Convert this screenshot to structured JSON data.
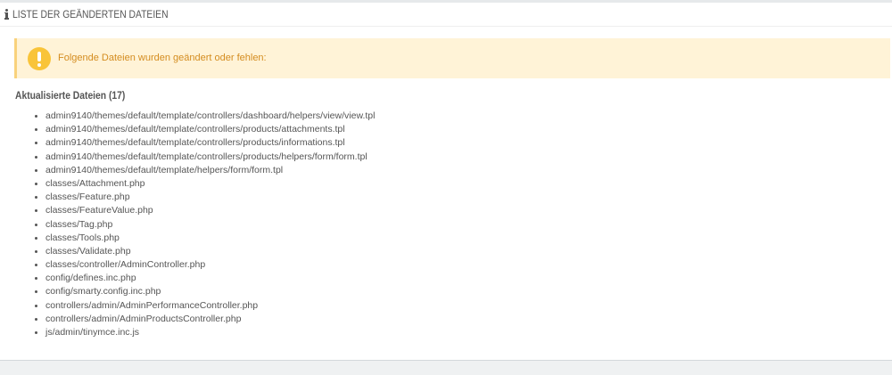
{
  "panel": {
    "title": "Liste der geänderten Dateien",
    "title_icon": "info-icon"
  },
  "alert": {
    "icon": "warning-icon",
    "message": "Folgende Dateien wurden geändert oder fehlen:",
    "colors": {
      "background": "#fff3d7",
      "border": "#f9d27c",
      "icon": "#f9c439",
      "text": "#d48c1f"
    }
  },
  "updated_files": {
    "heading": "Aktualisierte Dateien (17)",
    "items": [
      "admin9140/themes/default/template/controllers/dashboard/helpers/view/view.tpl",
      "admin9140/themes/default/template/controllers/products/attachments.tpl",
      "admin9140/themes/default/template/controllers/products/informations.tpl",
      "admin9140/themes/default/template/controllers/products/helpers/form/form.tpl",
      "admin9140/themes/default/template/helpers/form/form.tpl",
      "classes/Attachment.php",
      "classes/Feature.php",
      "classes/FeatureValue.php",
      "classes/Tag.php",
      "classes/Tools.php",
      "classes/Validate.php",
      "classes/controller/AdminController.php",
      "config/defines.inc.php",
      "config/smarty.config.inc.php",
      "controllers/admin/AdminPerformanceController.php",
      "controllers/admin/AdminProductsController.php",
      "js/admin/tinymce.inc.js"
    ]
  }
}
